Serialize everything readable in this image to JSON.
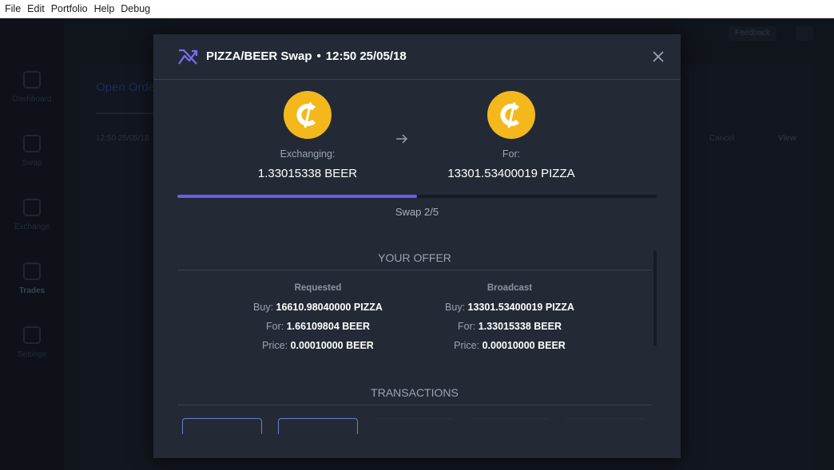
{
  "menubar": {
    "items": [
      "File",
      "Edit",
      "Portfolio",
      "Help",
      "Debug"
    ]
  },
  "background_app": {
    "nav": [
      {
        "label": "Dashboard",
        "icon": "dashboard-icon"
      },
      {
        "label": "Swap",
        "icon": "swap-icon"
      },
      {
        "label": "Exchange",
        "icon": "exchange-icon"
      },
      {
        "label": "Trades",
        "icon": "trades-icon",
        "active": true
      },
      {
        "label": "Settings",
        "icon": "settings-icon"
      }
    ],
    "feedback_button": "Feedback",
    "heading": "Open Orders",
    "row_time": "12:50 25/05/18",
    "cancel_label": "Cancel",
    "view_label": "View"
  },
  "modal": {
    "title": "PIZZA/BEER Swap",
    "datetime": "12:50 25/05/18",
    "separator": "•",
    "exchanging_label": "Exchanging:",
    "exchanging_amount": "1.33015338 BEER",
    "for_label": "For:",
    "for_amount": "13301.53400019 PIZZA",
    "progress_fraction": 0.5,
    "swap_step": "Swap 2/5",
    "your_offer_title": "YOUR OFFER",
    "requested": {
      "heading": "Requested",
      "buy_key": "Buy:",
      "buy_val": "16610.98040000 PIZZA",
      "for_key": "For:",
      "for_val": "1.66109804 BEER",
      "price_key": "Price:",
      "price_val": "0.00010000 BEER"
    },
    "broadcast": {
      "heading": "Broadcast",
      "buy_key": "Buy:",
      "buy_val": "13301.53400019 PIZZA",
      "for_key": "For:",
      "for_val": "1.33015338 BEER",
      "price_key": "Price:",
      "price_val": "0.00010000 BEER"
    },
    "transactions_title": "TRANSACTIONS",
    "colors": {
      "accent": "#6b5de5",
      "coin": "#f4b81c",
      "modal_bg": "#232a36"
    },
    "icons": [
      "swap-trend-icon",
      "close-icon",
      "coin-icon",
      "arrow-right-icon"
    ]
  }
}
